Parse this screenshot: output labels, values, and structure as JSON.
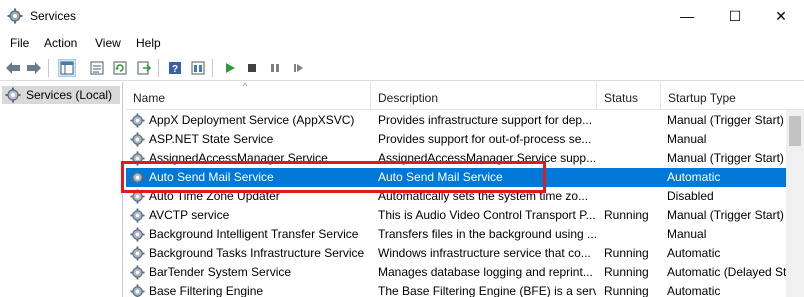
{
  "window": {
    "title": "Services",
    "minimize": "—",
    "maximize": "☐",
    "close": "✕"
  },
  "menu": [
    "File",
    "Action",
    "View",
    "Help"
  ],
  "toolbar": [
    "back-arrow-icon",
    "forward-arrow-icon",
    "console-tree-icon",
    "properties-icon",
    "refresh-icon",
    "export-list-icon",
    "help-icon",
    "view-icon",
    "start-service-icon",
    "stop-service-icon",
    "pause-service-icon",
    "restart-service-icon"
  ],
  "tree": {
    "label": "Services (Local)"
  },
  "columns": {
    "name": "Name",
    "description": "Description",
    "status": "Status",
    "startup": "Startup Type"
  },
  "rows": [
    {
      "name": "AppX Deployment Service (AppXSVC)",
      "description": "Provides infrastructure support for dep...",
      "status": "",
      "startup": "Manual (Trigger Start)"
    },
    {
      "name": "ASP.NET State Service",
      "description": "Provides support for out-of-process se...",
      "status": "",
      "startup": "Manual"
    },
    {
      "name": "AssignedAccessManager Service",
      "description": "AssignedAccessManager Service supp...",
      "status": "",
      "startup": "Manual (Trigger Start)"
    },
    {
      "name": "Auto Send Mail Service",
      "description": "Auto Send Mail Service",
      "status": "",
      "startup": "Automatic"
    },
    {
      "name": "Auto Time Zone Updater",
      "description": "Automatically sets the system time zo...",
      "status": "",
      "startup": "Disabled"
    },
    {
      "name": "AVCTP service",
      "description": "This is Audio Video Control Transport P...",
      "status": "Running",
      "startup": "Manual (Trigger Start)"
    },
    {
      "name": "Background Intelligent Transfer Service",
      "description": "Transfers files in the background using ...",
      "status": "",
      "startup": "Manual"
    },
    {
      "name": "Background Tasks Infrastructure Service",
      "description": "Windows infrastructure service that co...",
      "status": "Running",
      "startup": "Automatic"
    },
    {
      "name": "BarTender System Service",
      "description": "Manages database logging and reprint...",
      "status": "Running",
      "startup": "Automatic (Delayed St"
    },
    {
      "name": "Base Filtering Engine",
      "description": "The Base Filtering Engine (BFE) is a serv...",
      "status": "Running",
      "startup": "Automatic"
    }
  ],
  "selected_row": 3,
  "colors": {
    "selection": "#0078d7",
    "highlight_border": "#e0191c"
  }
}
